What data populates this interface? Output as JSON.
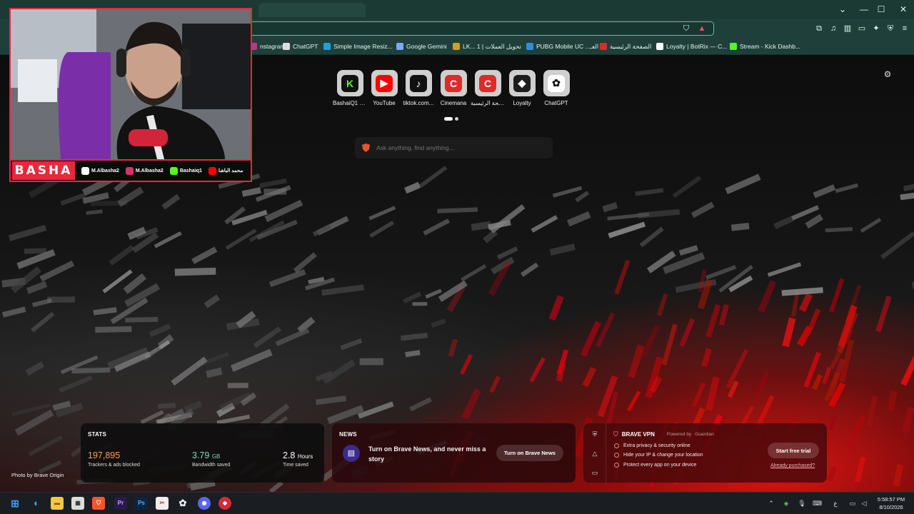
{
  "colors": {
    "accent_teal": "#3fd0a6",
    "stream_red": "#e8283c",
    "stats_orange": "#f5a25d",
    "stats_green": "#7fd6c0"
  },
  "window_controls": {
    "minimize": "—",
    "maximize": "☐",
    "close": "✕",
    "tabs_menu": "⌄"
  },
  "toolbar": {
    "shield_icon": "brave-shield-icon",
    "rewards_icon": "brave-rewards-icon",
    "right_icons": [
      "extensions-icon",
      "music-icon",
      "sidebar-icon",
      "wallet-icon",
      "leo-ai-icon",
      "vpn-shield-icon",
      "menu-icon"
    ]
  },
  "bookmarks": [
    {
      "label": "nstagram",
      "icon": "instagram-icon",
      "color": "#c13584"
    },
    {
      "label": "ChatGPT",
      "icon": "chatgpt-icon",
      "color": "#dddddd"
    },
    {
      "label": "Simple Image Resiz...",
      "icon": "image-resize-icon",
      "color": "#1aa3d6"
    },
    {
      "label": "Google Gemini",
      "icon": "gemini-icon",
      "color": "#7aa8ff"
    },
    {
      "label": "LK... 1 | تحويل العملات",
      "icon": "currency-icon",
      "color": "#c9a227"
    },
    {
      "label": "PUBG Mobile UC ...العـ",
      "icon": "pubg-icon",
      "color": "#2f8de0"
    },
    {
      "label": "الصفحة الرئيسية",
      "icon": "cinemana-icon",
      "color": "#e02a2a"
    },
    {
      "label": "Loyalty | BotRix — C...",
      "icon": "botrix-icon",
      "color": "#ffffff"
    },
    {
      "label": "Stream - Kick Dashb...",
      "icon": "kick-icon",
      "color": "#53fc18"
    }
  ],
  "top_sites": [
    {
      "label": "BashaiQ1 S...",
      "icon": "kick-icon",
      "glyph": "K",
      "bg": "#111111",
      "fg": "#53fc18"
    },
    {
      "label": "YouTube",
      "icon": "youtube-icon",
      "glyph": "▶",
      "bg": "#ff0000",
      "fg": "#ffffff"
    },
    {
      "label": "tiktok.com...",
      "icon": "tiktok-icon",
      "glyph": "♪",
      "bg": "#111111",
      "fg": "#ffffff"
    },
    {
      "label": "Cinemana",
      "icon": "cinemana-icon",
      "glyph": "C",
      "bg": "#e02a2a",
      "fg": "#ffffff"
    },
    {
      "label": "الصفحة الرئيسية",
      "icon": "cinemana-icon",
      "glyph": "C",
      "bg": "#e02a2a",
      "fg": "#ffffff"
    },
    {
      "label": "Loyalty",
      "icon": "botrix-icon",
      "glyph": "◆",
      "bg": "#1d1d1d",
      "fg": "#ffffff"
    },
    {
      "label": "ChatGPT",
      "icon": "chatgpt-icon",
      "glyph": "✿",
      "bg": "#ffffff",
      "fg": "#111111"
    }
  ],
  "search": {
    "placeholder": "Ask anything, find anything..."
  },
  "webcam": {
    "brand": "BASHA",
    "socials": [
      {
        "label": "M.Albasha2",
        "icon": "tiktok-icon",
        "color": "#ffffff"
      },
      {
        "label": "M.Albasha2",
        "icon": "instagram-icon",
        "color": "#d6336c"
      },
      {
        "label": "Bashaiq1",
        "icon": "kick-icon",
        "color": "#53fc18"
      },
      {
        "label": "محمد الباشا",
        "icon": "youtube-icon",
        "color": "#ff0000"
      }
    ]
  },
  "stats": {
    "title": "STATS",
    "trackers_value": "197,895",
    "trackers_label": "Trackers & ads blocked",
    "bandwidth_value": "3.79",
    "bandwidth_unit": "GB",
    "bandwidth_label": "Bandwidth saved",
    "time_value": "2.8",
    "time_unit": "Hours",
    "time_label": "Time saved"
  },
  "news": {
    "title": "NEWS",
    "text": "Turn on Brave News, and never miss a story",
    "button": "Turn on Brave News"
  },
  "vpn": {
    "title": "BRAVE VPN",
    "powered": "Powered by",
    "partner": "Guardian",
    "features": [
      "Extra privacy & security online",
      "Hide your IP & change your location",
      "Protect every app on your device"
    ],
    "button": "Start free trial",
    "link": "Already purchased?"
  },
  "photo_credit": "Photo by Brave Origin",
  "taskbar": {
    "apps": [
      "windows-start-icon",
      "edge-icon",
      "file-explorer-icon",
      "store-icon",
      "brave-icon",
      "premiere-icon",
      "photoshop-icon",
      "snipping-icon",
      "chatgpt-icon",
      "discord-icon",
      "app-icon"
    ],
    "tray_lang": "ع",
    "time": "5:58:57 PM",
    "date": "8/10/2026"
  }
}
